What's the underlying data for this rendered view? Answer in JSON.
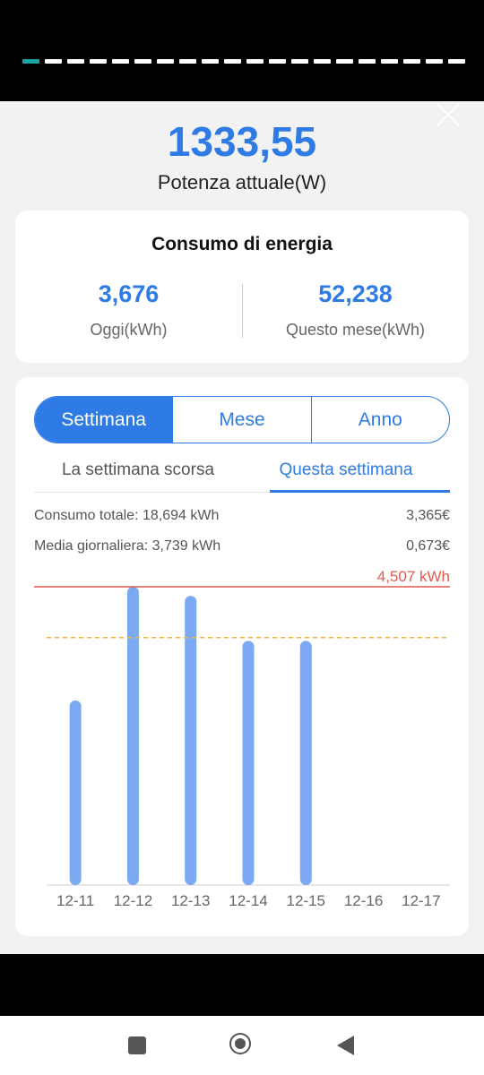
{
  "story": {
    "segment_count": 20,
    "active_index": 0
  },
  "header": {
    "power_value": "1333,55",
    "power_label": "Potenza attuale(W)"
  },
  "energy": {
    "title": "Consumo di energia",
    "today_value": "3,676",
    "today_label": "Oggi(kWh)",
    "month_value": "52,238",
    "month_label": "Questo mese(kWh)"
  },
  "period_tabs": [
    {
      "label": "Settimana",
      "active": true
    },
    {
      "label": "Mese",
      "active": false
    },
    {
      "label": "Anno",
      "active": false
    }
  ],
  "week_tabs": {
    "last": "La settimana scorsa",
    "current": "Questa settimana",
    "active": "current"
  },
  "summary": {
    "total_label": "Consumo totale: 18,694 kWh",
    "total_cost": "3,365€",
    "avg_label": "Media giornaliera: 3,739 kWh",
    "avg_cost": "0,673€"
  },
  "chart_data": {
    "type": "bar",
    "categories": [
      "12-11",
      "12-12",
      "12-13",
      "12-14",
      "12-15",
      "12-16",
      "12-17"
    ],
    "values": [
      2.79,
      4.507,
      4.37,
      3.69,
      3.69,
      0,
      0
    ],
    "max_label": "4,507 kWh",
    "max_value": 4.507,
    "average_value": 3.739,
    "ylim": [
      0,
      4.507
    ],
    "unit": "kWh",
    "colors": {
      "bar": "#7baaf2",
      "max_line": "#e05a4f",
      "avg_line": "#f0b43c"
    }
  },
  "icons": {
    "close": "close-icon",
    "nav_recent": "square-icon",
    "nav_home": "home-circle-icon",
    "nav_back": "back-triangle-icon"
  }
}
